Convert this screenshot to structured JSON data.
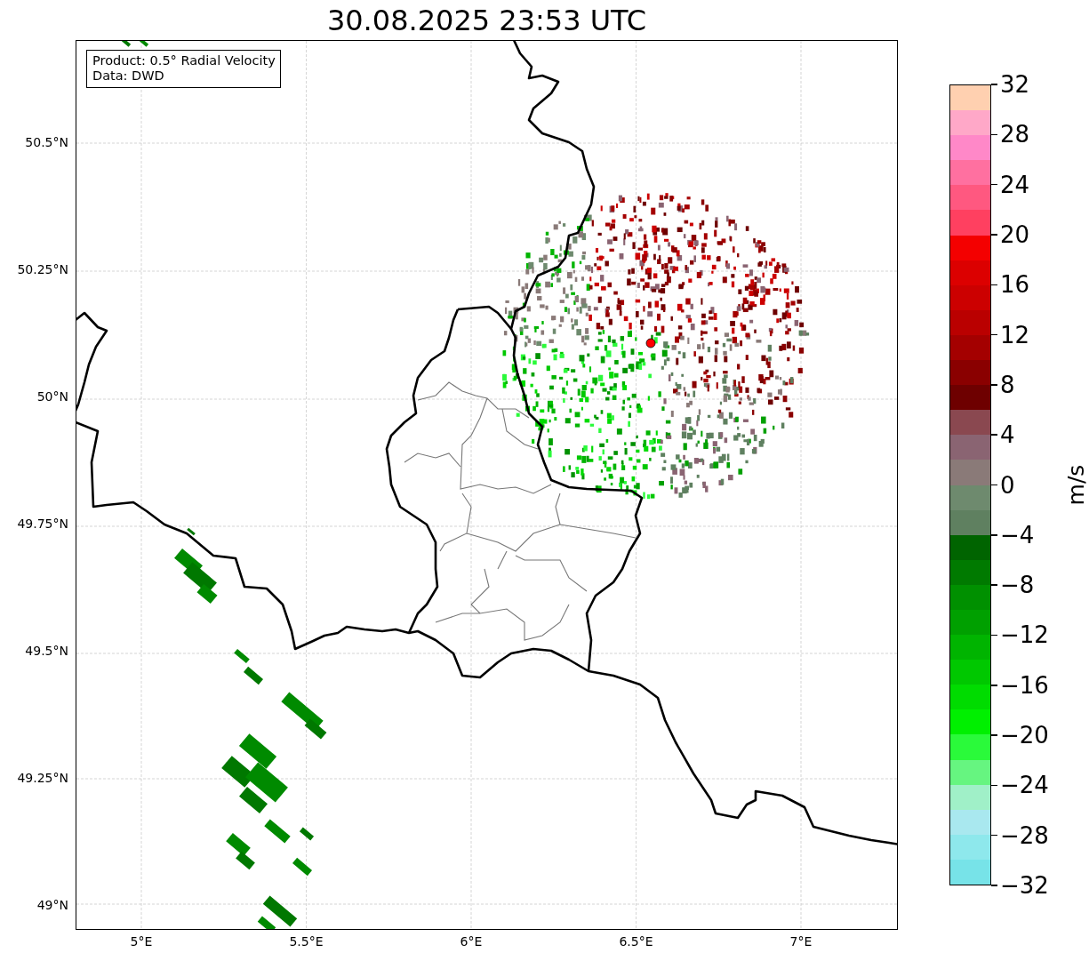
{
  "title": "30.08.2025 23:53 UTC",
  "info_box": {
    "lines": [
      "Product: 0.5° Radial Velocity",
      "Data: DWD"
    ]
  },
  "map": {
    "y_ticks": [
      "50.5°N",
      "50.25°N",
      "50°N",
      "49.75°N",
      "49.5°N",
      "49.25°N",
      "49°N"
    ],
    "x_ticks": [
      "5°E",
      "5.5°E",
      "6°E",
      "6.5°E",
      "7°E"
    ]
  },
  "colorbar": {
    "label": "m/s",
    "ticks": [
      "32",
      "28",
      "24",
      "20",
      "16",
      "12",
      "8",
      "4",
      "0",
      "−4",
      "−8",
      "−12",
      "−16",
      "−20",
      "−24",
      "−28",
      "−32"
    ],
    "segments": [
      {
        "color": "#77e3e8"
      },
      {
        "color": "#8ee8ec"
      },
      {
        "color": "#a9e8ef"
      },
      {
        "color": "#a0f0c8"
      },
      {
        "color": "#66f580"
      },
      {
        "color": "#2afa3a"
      },
      {
        "color": "#00f000"
      },
      {
        "color": "#00dc00"
      },
      {
        "color": "#00c800"
      },
      {
        "color": "#00b400"
      },
      {
        "color": "#00a000"
      },
      {
        "color": "#009000"
      },
      {
        "color": "#007a00"
      },
      {
        "color": "#006400"
      },
      {
        "color": "#5f8060"
      },
      {
        "color": "#6e8a6e"
      },
      {
        "color": "#8a7a78"
      },
      {
        "color": "#8a6472"
      },
      {
        "color": "#8a4850"
      },
      {
        "color": "#6e0000"
      },
      {
        "color": "#8a0000"
      },
      {
        "color": "#a40000"
      },
      {
        "color": "#ba0000"
      },
      {
        "color": "#cc0000"
      },
      {
        "color": "#dc0000"
      },
      {
        "color": "#f40000"
      },
      {
        "color": "#ff4060"
      },
      {
        "color": "#ff5880"
      },
      {
        "color": "#ff70a0"
      },
      {
        "color": "#ff88c8"
      },
      {
        "color": "#ffa8c8"
      },
      {
        "color": "#ffd0b0"
      }
    ]
  }
}
